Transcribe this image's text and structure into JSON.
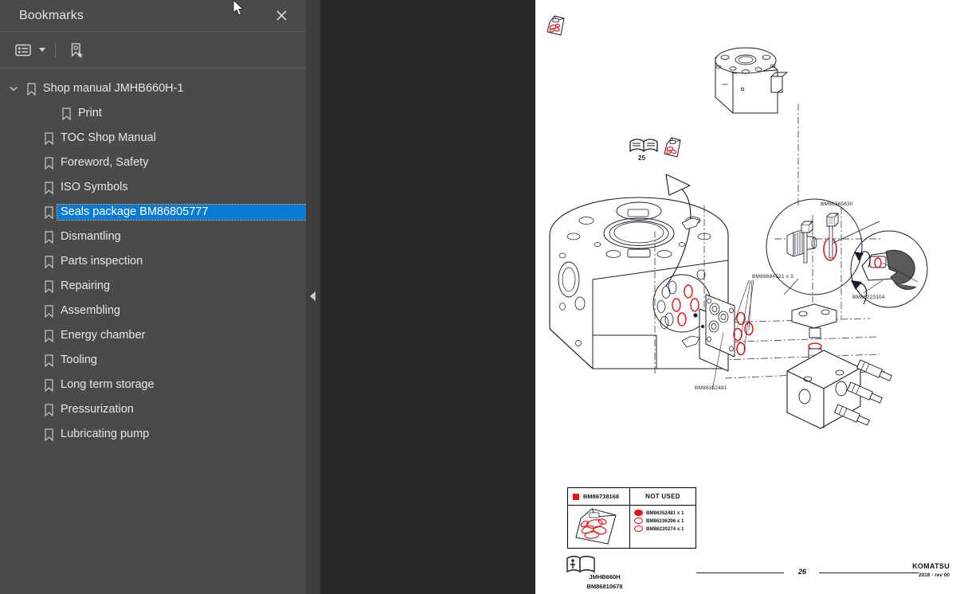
{
  "panel": {
    "title": "Bookmarks",
    "close_icon": "close-icon",
    "toolbar": {
      "options_label": "bookmark-options",
      "options_icon": "list-options-icon",
      "caret_icon": "chevron-down-icon",
      "new_bookmark_icon": "new-bookmark-icon"
    },
    "items": [
      {
        "label": "Shop manual JMHB660H-1",
        "level": 0,
        "expanded": true,
        "selected": false,
        "icon": "bookmark-icon"
      },
      {
        "label": "Print",
        "level": 2,
        "expanded": null,
        "selected": false,
        "icon": "bookmark-icon"
      },
      {
        "label": "TOC Shop Manual",
        "level": 1,
        "expanded": null,
        "selected": false,
        "icon": "bookmark-icon"
      },
      {
        "label": "Foreword, Safety",
        "level": 1,
        "expanded": null,
        "selected": false,
        "icon": "bookmark-icon"
      },
      {
        "label": "ISO Symbols",
        "level": 1,
        "expanded": null,
        "selected": false,
        "icon": "bookmark-icon"
      },
      {
        "label": "Seals package BM86805777",
        "level": 1,
        "expanded": null,
        "selected": true,
        "icon": "bookmark-icon"
      },
      {
        "label": "Dismantling",
        "level": 1,
        "expanded": null,
        "selected": false,
        "icon": "bookmark-icon"
      },
      {
        "label": "Parts inspection",
        "level": 1,
        "expanded": null,
        "selected": false,
        "icon": "bookmark-icon"
      },
      {
        "label": "Repairing",
        "level": 1,
        "expanded": null,
        "selected": false,
        "icon": "bookmark-icon"
      },
      {
        "label": "Assembling",
        "level": 1,
        "expanded": null,
        "selected": false,
        "icon": "bookmark-icon"
      },
      {
        "label": "Energy chamber",
        "level": 1,
        "expanded": null,
        "selected": false,
        "icon": "bookmark-icon"
      },
      {
        "label": "Tooling",
        "level": 1,
        "expanded": null,
        "selected": false,
        "icon": "bookmark-icon"
      },
      {
        "label": "Long term storage",
        "level": 1,
        "expanded": null,
        "selected": false,
        "icon": "bookmark-icon"
      },
      {
        "label": "Pressurization",
        "level": 1,
        "expanded": null,
        "selected": false,
        "icon": "bookmark-icon"
      },
      {
        "label": "Lubricating pump",
        "level": 1,
        "expanded": null,
        "selected": false,
        "icon": "bookmark-icon"
      }
    ]
  },
  "splitter": {
    "collapse_icon": "collapse-panel-arrow-icon"
  },
  "page": {
    "top_marks": {
      "manual_ref": "25",
      "book_icon": "open-book-icon",
      "seal_bag_icon": "seal-bag-icon"
    },
    "callouts": [
      {
        "id": "c1",
        "text": "BM86365830"
      },
      {
        "id": "c2",
        "text": "BM86684521 x 3"
      },
      {
        "id": "c3",
        "text": "BM86223104"
      },
      {
        "id": "c4",
        "text": "BM86352481"
      }
    ],
    "legend": {
      "kit_code": "BM86738168",
      "not_used_header": "NOT USED",
      "rows": [
        {
          "text": "BM86352481 x 1",
          "style": "filled"
        },
        {
          "text": "BM86236296 x 1",
          "style": "open"
        },
        {
          "text": "BM86220274 x 1",
          "style": "open"
        }
      ]
    },
    "footer": {
      "model": "JMHB660H",
      "doc_code": "BM86810678",
      "page_number": "26",
      "brand": "KOMATSU",
      "revision": "2018 -  rev 00",
      "book_icon": "manual-book-icon"
    }
  },
  "colors": {
    "panel_bg": "#4a4a4a",
    "viewer_bg": "#282828",
    "selection": "#0b7ad4",
    "accent_red": "#ee1111",
    "page_bg": "#ffffff"
  }
}
